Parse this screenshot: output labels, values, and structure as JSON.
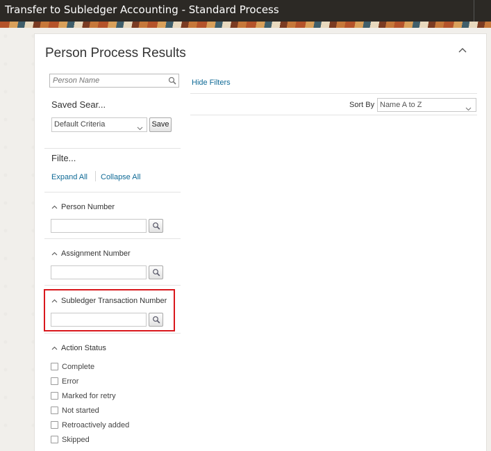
{
  "window": {
    "title": "Transfer to Subledger Accounting - Standard Process"
  },
  "panel": {
    "title": "Person Process Results"
  },
  "search": {
    "placeholder": "Person Name"
  },
  "saved_search": {
    "label": "Saved Sear...",
    "selected": "Default Criteria",
    "save_label": "Save"
  },
  "filters": {
    "label": "Filte...",
    "expand_all": "Expand All",
    "collapse_all": "Collapse All",
    "sections": [
      {
        "label": "Person Number",
        "value": ""
      },
      {
        "label": "Assignment Number",
        "value": ""
      },
      {
        "label": "Subledger Transaction Number",
        "value": ""
      }
    ],
    "action_status": {
      "label": "Action Status",
      "options": [
        "Complete",
        "Error",
        "Marked for retry",
        "Not started",
        "Retroactively added",
        "Skipped"
      ]
    }
  },
  "results": {
    "hide_filters": "Hide Filters",
    "sort_by_label": "Sort By",
    "sort_by_value": "Name A to Z"
  },
  "colors": {
    "title_bar": "#2c2925",
    "link": "#0f6a96",
    "highlight": "#d9171c"
  }
}
